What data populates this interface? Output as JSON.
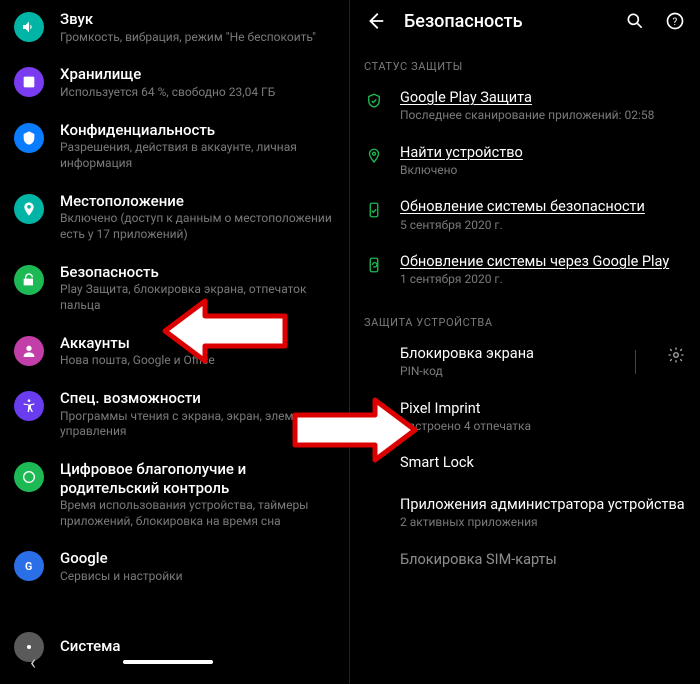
{
  "left": {
    "items": [
      {
        "title": "Звук",
        "sub": "Громкость, вибрация, режим \"Не беспокоить\"",
        "iconColor": "#00b5a5"
      },
      {
        "title": "Хранилище",
        "sub": "Используется 64 %, свободно 23,04 ГБ",
        "iconColor": "#7a3cf0"
      },
      {
        "title": "Конфиденциальность",
        "sub": "Разрешения, действия в аккаунте, личная информация",
        "iconColor": "#0a7cff"
      },
      {
        "title": "Местоположение",
        "sub": "Включено (доступ к данным о местоположении есть у 17 приложений)",
        "iconColor": "#00b5a5"
      },
      {
        "title": "Безопасность",
        "sub": "Play Защита, блокировка экрана, отпечаток пальца",
        "iconColor": "#1db954"
      },
      {
        "title": "Аккаунты",
        "sub": "Нова пошта, Google и Office",
        "iconColor": "#c23ea8"
      },
      {
        "title": "Спец. возможности",
        "sub": "Программы чтения с экрана, экран, элементы управления",
        "iconColor": "#6a3cf0"
      },
      {
        "title": "Цифровое благополучие и родительский контроль",
        "sub": "Время использования устройства, таймеры приложений, блокировка на время сна",
        "iconColor": "#1db954"
      },
      {
        "title": "Google",
        "sub": "Сервисы и настройки",
        "iconColor": "#2a6fe8"
      }
    ],
    "system_label": "Система"
  },
  "right": {
    "header": {
      "title": "Безопасность"
    },
    "section1": "СТАТУС ЗАЩИТЫ",
    "status": [
      {
        "icon": "shield",
        "title": "Google Play Защита",
        "sub": "Последнее сканирование приложений: 02:58",
        "underline": true
      },
      {
        "icon": "pin",
        "title": "Найти устройство",
        "sub": "Включено",
        "underline": true
      },
      {
        "icon": "phone-check",
        "title": "Обновление системы безопасности",
        "sub": "5 сентября 2020 г.",
        "underline": true
      },
      {
        "icon": "phone-ref",
        "title": "Обновление системы через Google Play",
        "sub": "1 сентября 2020 г.",
        "underline": true
      }
    ],
    "section2": "ЗАЩИТА УСТРОЙСТВА",
    "device": [
      {
        "title": "Блокировка экрана",
        "sub": "PIN-код",
        "gear": true
      },
      {
        "title": "Pixel Imprint",
        "sub": "Настроено 4 отпечатка"
      },
      {
        "title": "Smart Lock",
        "sub": ""
      },
      {
        "title": "Приложения администратора устройства",
        "sub": "2 активных приложения"
      },
      {
        "title": "Блокировка SIM-карты",
        "sub": ""
      }
    ]
  }
}
